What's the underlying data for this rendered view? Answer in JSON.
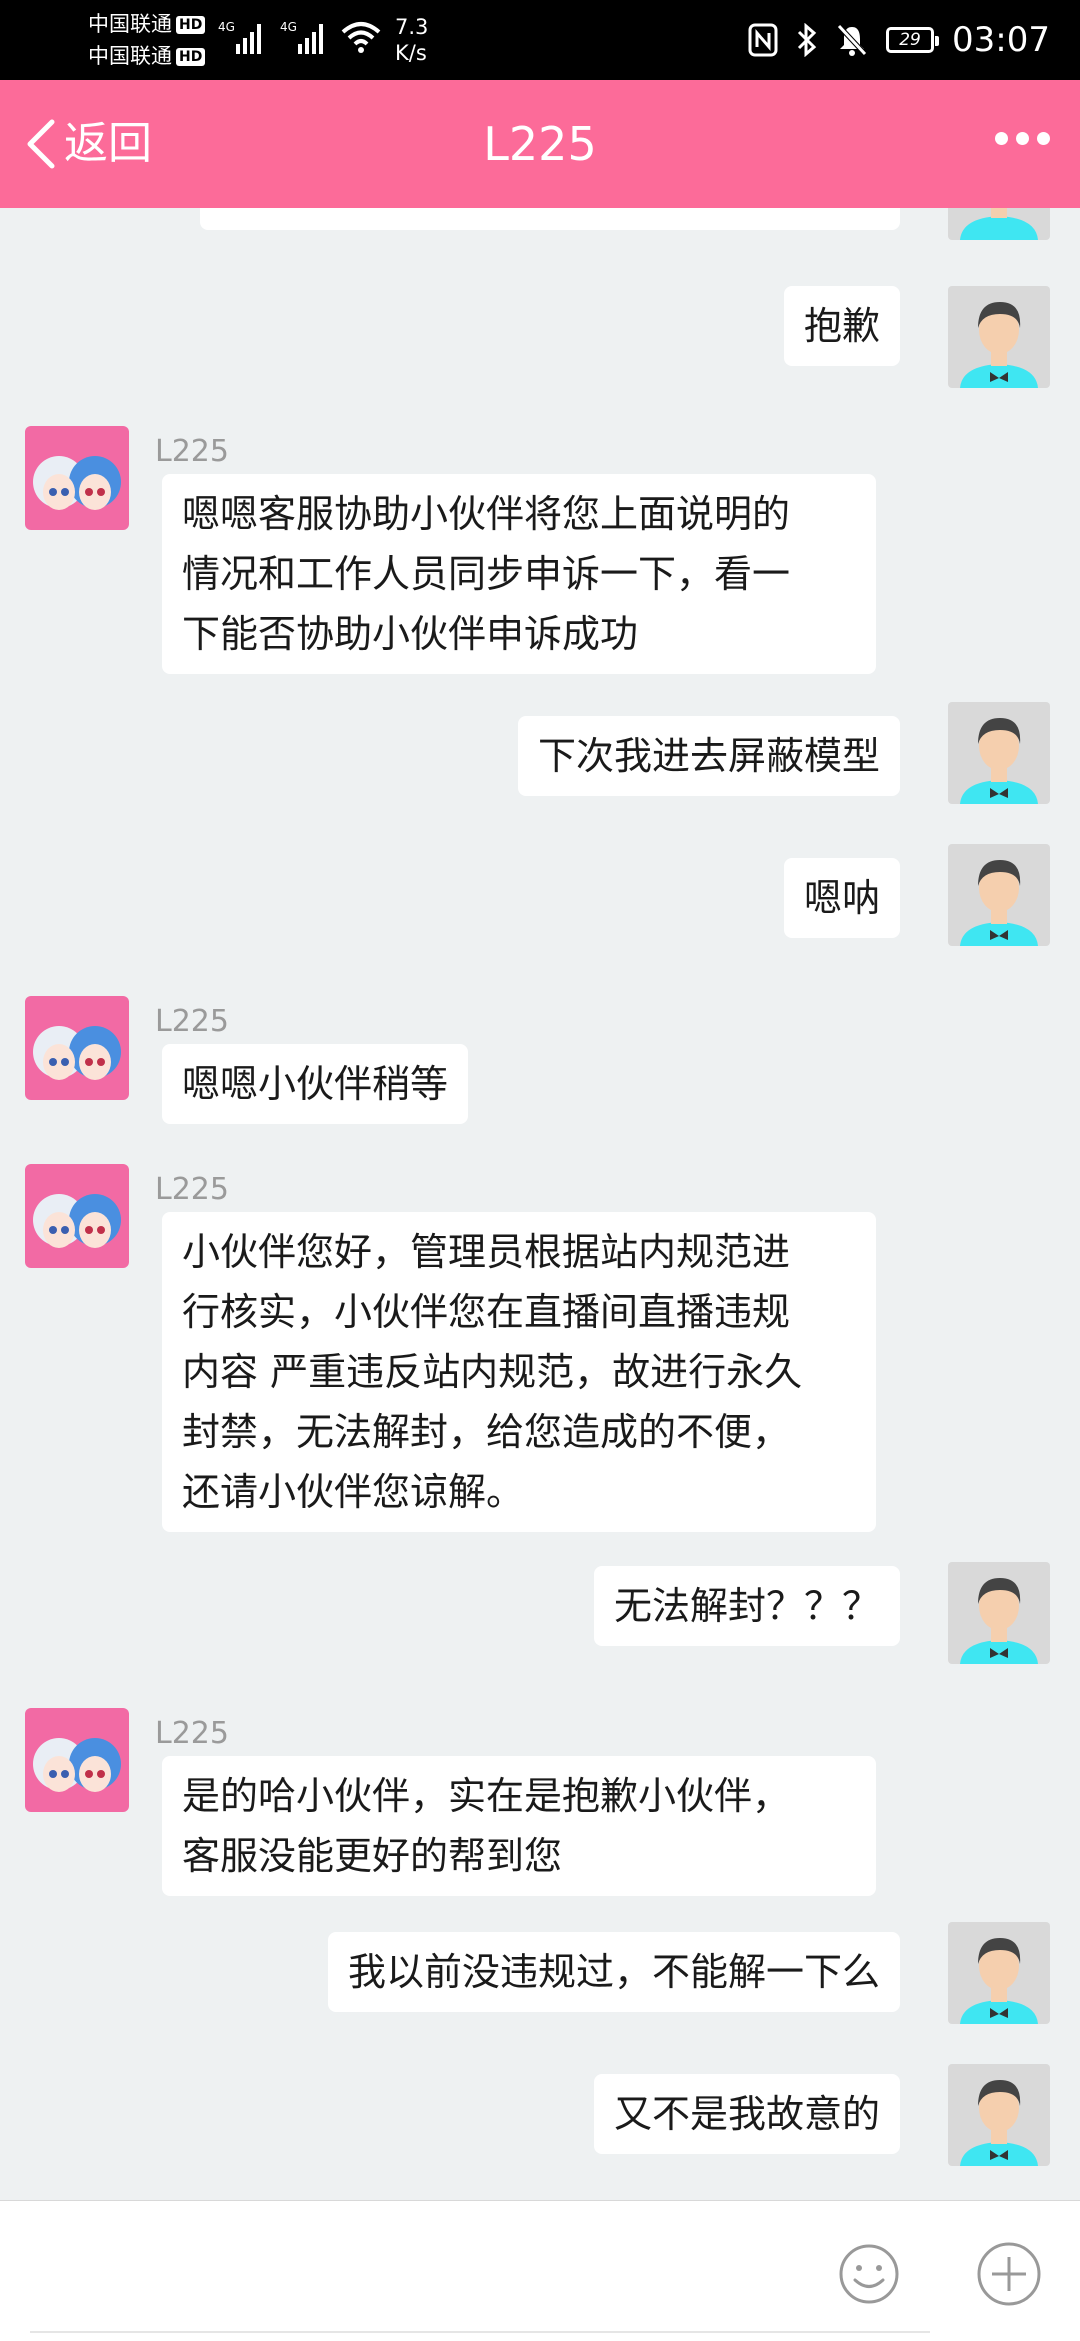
{
  "status_bar": {
    "carrier1": "中国联通",
    "carrier2": "中国联通",
    "hd_badge": "HD",
    "network_type": "4G",
    "net_speed_value": "7.3",
    "net_speed_unit": "K/s",
    "battery_level": "29",
    "time": "03:07"
  },
  "header": {
    "back_label": "返回",
    "title": "L225",
    "more_icon": "more-dots-icon"
  },
  "conversation": {
    "partial_message": "…",
    "messages": [
      {
        "side": "right",
        "text": "抱歉"
      },
      {
        "side": "left",
        "sender": "L225",
        "text": "嗯嗯客服协助小伙伴将您上面说明的\n情况和工作人员同步申诉一下，看一\n下能否协助小伙伴申诉成功"
      },
      {
        "side": "right",
        "text": "下次我进去屏蔽模型"
      },
      {
        "side": "right",
        "text": "嗯呐"
      },
      {
        "side": "left",
        "sender": "L225",
        "text": "嗯嗯小伙伴稍等"
      },
      {
        "side": "left",
        "sender": "L225",
        "text": "小伙伴您好，管理员根据站内规范进\n行核实，小伙伴您在直播间直播违规\n内容 严重违反站内规范，故进行永久\n封禁，无法解封，给您造成的不便，\n还请小伙伴您谅解。"
      },
      {
        "side": "right",
        "text": "无法解封？？？"
      },
      {
        "side": "left",
        "sender": "L225",
        "text": "是的哈小伙伴，实在是抱歉小伙伴，\n客服没能更好的帮到您"
      },
      {
        "side": "right",
        "text": "我以前没违规过，不能解一下么"
      },
      {
        "side": "right",
        "text": "又不是我故意的"
      }
    ]
  },
  "input_bar": {
    "emoji_icon": "emoji-icon",
    "plus_icon": "plus-circle-icon"
  },
  "colors": {
    "header_bg": "#fc6b99",
    "chat_bg": "#eef1f2",
    "bubble_bg": "#ffffff",
    "user_avatar_shirt": "#3fe6f2"
  }
}
